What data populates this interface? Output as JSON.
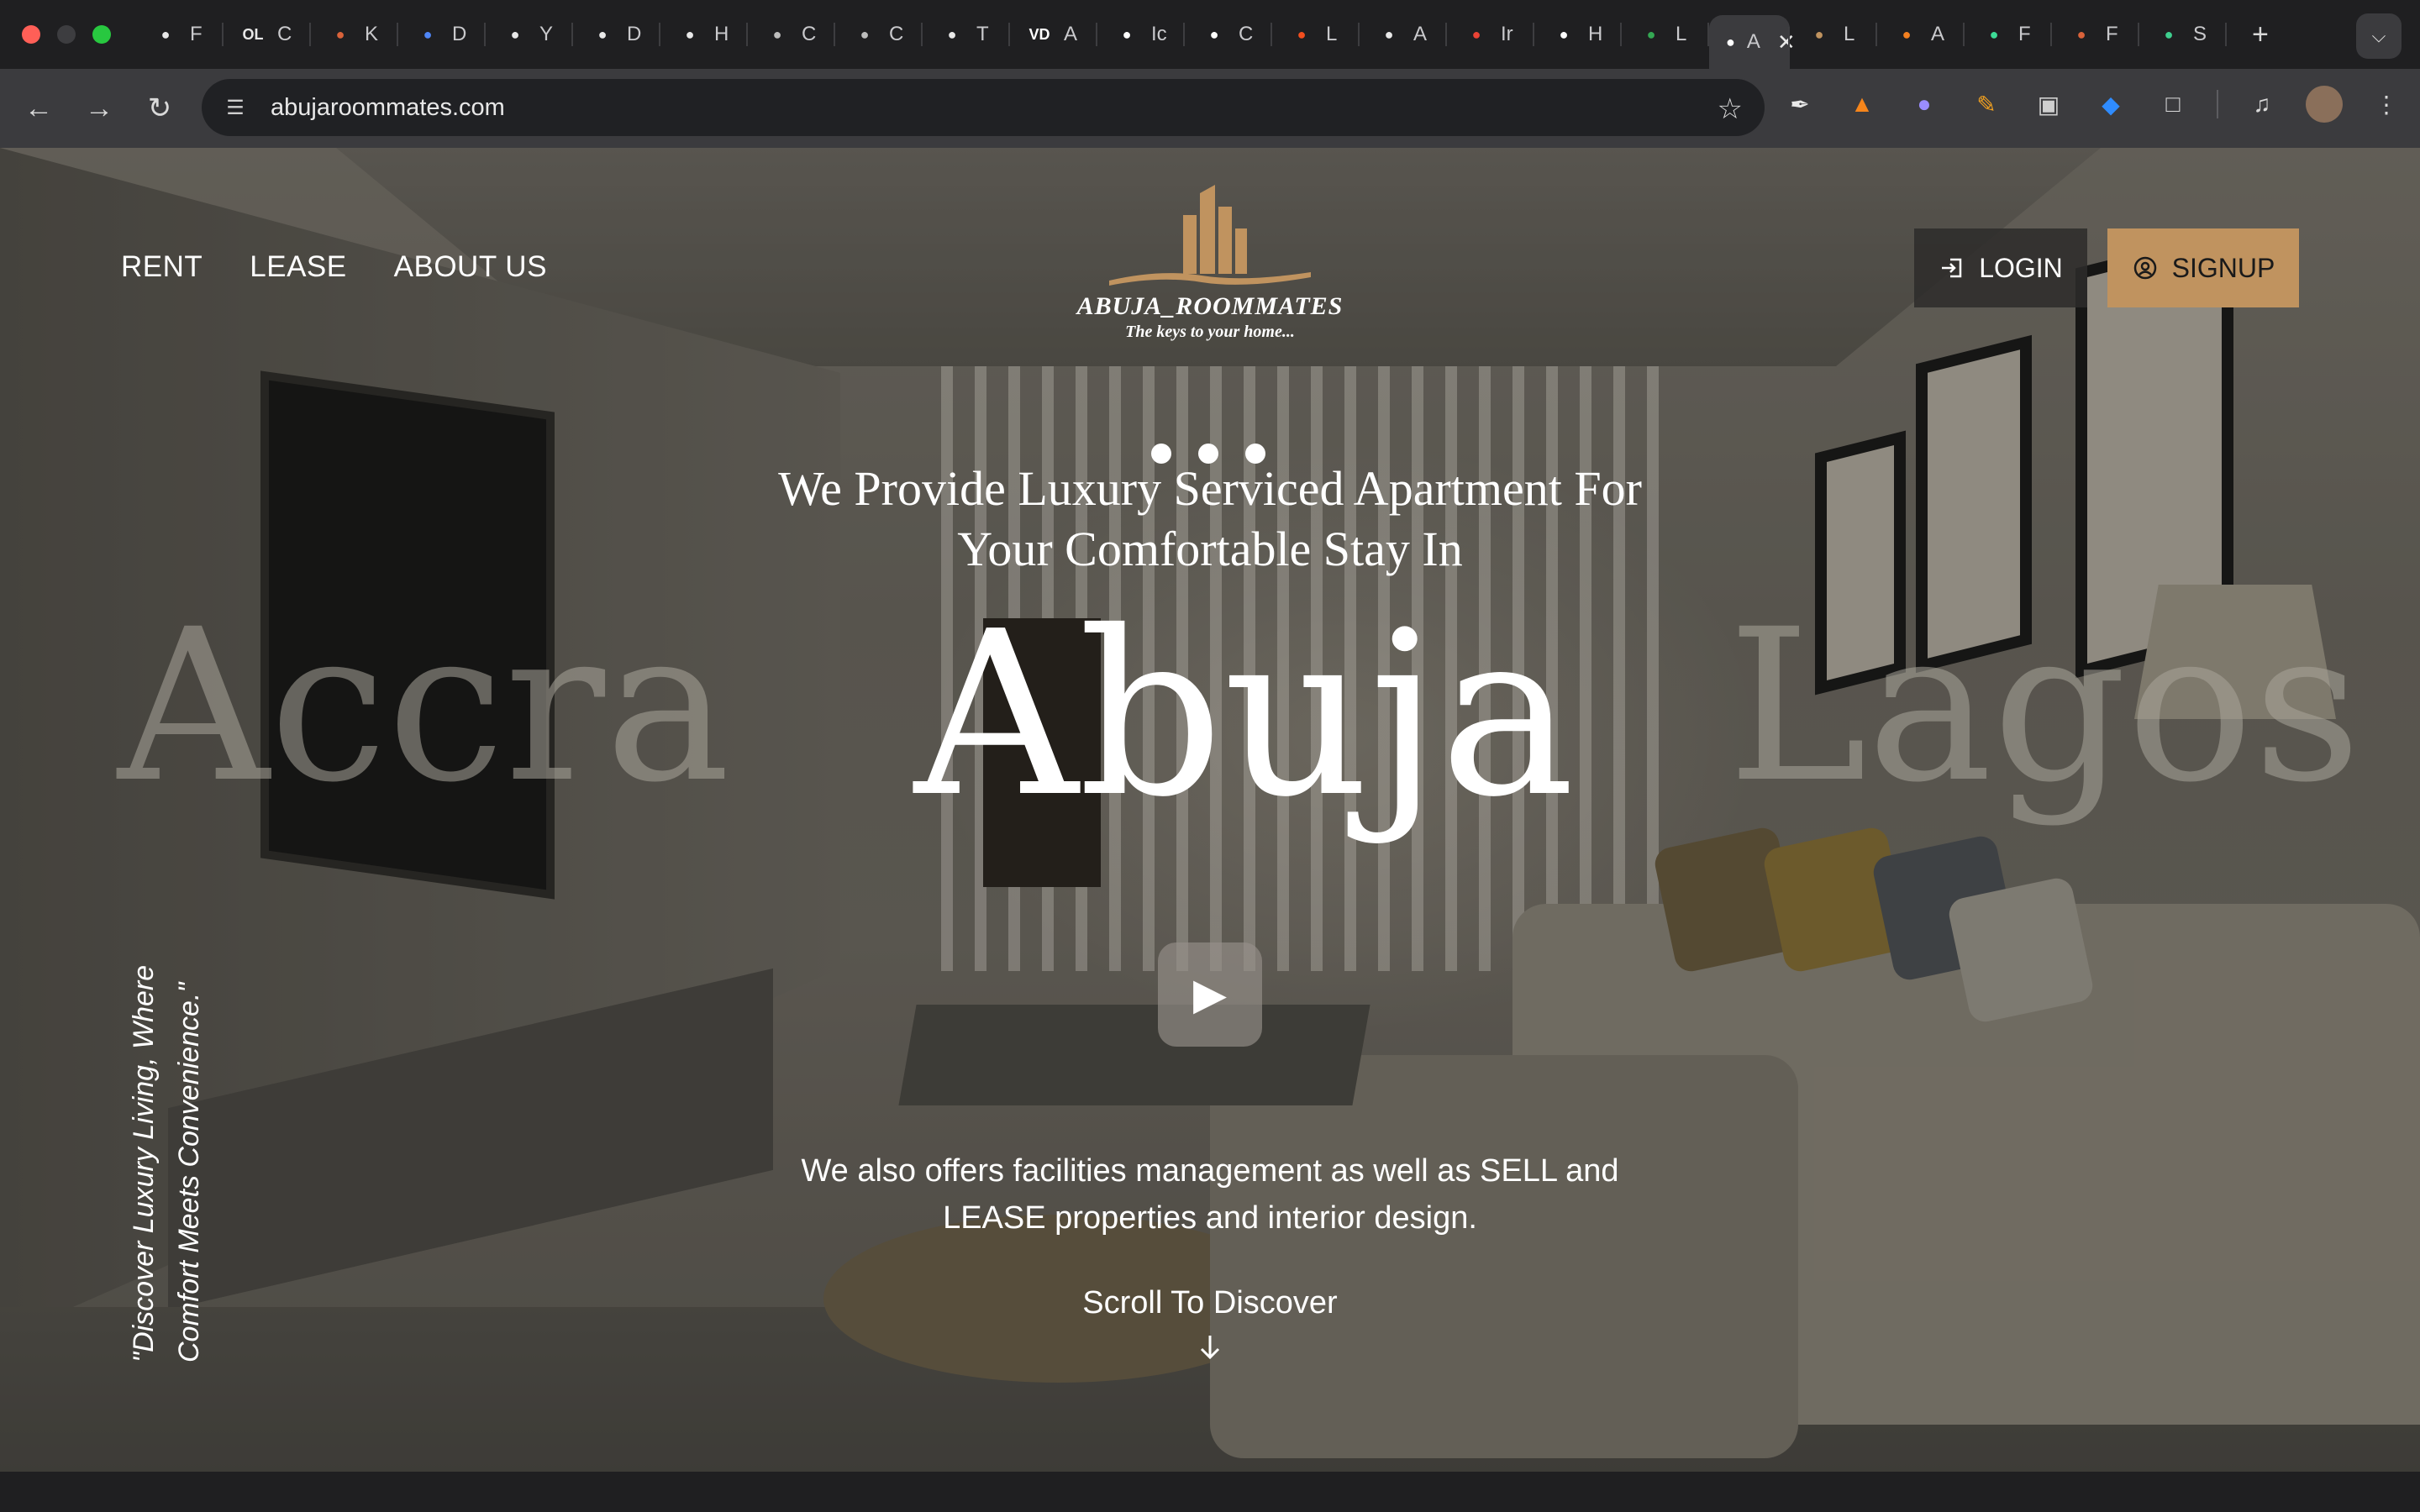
{
  "browser": {
    "tabs": [
      {
        "icon": "openai-icon",
        "title": "F",
        "color": "#e8e8e8"
      },
      {
        "icon": "openlibrary-icon",
        "title": "C",
        "favicon_text": "OL",
        "color": "#e8e8e8"
      },
      {
        "icon": "app-icon",
        "title": "K",
        "color": "#d9623a"
      },
      {
        "icon": "docs-icon",
        "title": "D",
        "color": "#4f86f7"
      },
      {
        "icon": "github-icon",
        "title": "Y",
        "color": "#e8e8e8"
      },
      {
        "icon": "github-icon",
        "title": "D",
        "color": "#e8e8e8"
      },
      {
        "icon": "site-icon",
        "title": "H",
        "color": "#e8e8e8"
      },
      {
        "icon": "globe-icon",
        "title": "C",
        "color": "#bdbdbd"
      },
      {
        "icon": "globe-icon",
        "title": "C",
        "color": "#bdbdbd"
      },
      {
        "icon": "book-icon",
        "title": "T",
        "color": "#e8e8e8"
      },
      {
        "icon": "app-icon",
        "title": "A",
        "favicon_text": "VD",
        "color": "#ffffff"
      },
      {
        "icon": "notion-icon",
        "title": "Ic",
        "color": "#ffffff"
      },
      {
        "icon": "site-icon",
        "title": "C",
        "color": "#ffffff"
      },
      {
        "icon": "figma-icon",
        "title": "L",
        "color": "#f24e1e"
      },
      {
        "icon": "speaker-icon",
        "title": "A",
        "color": "#e8e8e8"
      },
      {
        "icon": "gmail-icon",
        "title": "Ir",
        "color": "#ea4335"
      },
      {
        "icon": "x-icon",
        "title": "H",
        "color": "#ffffff"
      },
      {
        "icon": "play-icon",
        "title": "L",
        "color": "#34a853"
      },
      {
        "icon": "site-icon",
        "title": "A",
        "active": true,
        "color": "#ffffff"
      },
      {
        "icon": "site-icon",
        "title": "L",
        "color": "#c0935f"
      },
      {
        "icon": "cloud-icon",
        "title": "A",
        "color": "#f38020"
      },
      {
        "icon": "site-icon",
        "title": "F",
        "color": "#3ddc97"
      },
      {
        "icon": "site-icon",
        "title": "F",
        "color": "#d9623a"
      },
      {
        "icon": "bolt-icon",
        "title": "S",
        "color": "#3ecf8e"
      }
    ],
    "url": "abujaroommates.com"
  },
  "site": {
    "nav": {
      "rent": "RENT",
      "lease": "LEASE",
      "about": "ABOUT US"
    },
    "logo": {
      "name": "ABUJA_ROOMMATES",
      "tagline": "The keys to your home..."
    },
    "auth": {
      "login": "LOGIN",
      "signup": "SIGNUP"
    },
    "hero": {
      "headline_line1": "We Provide Luxury Serviced Apartment For",
      "headline_line2": "Your Comfortable Stay In",
      "city_prev": "Accra",
      "city_current": "Abuja",
      "city_next": "Lagos",
      "subtext_line1": "We also offers facilities management as well as SELL and",
      "subtext_line2": "LEASE properties and interior design.",
      "scroll_label": "Scroll To Discover",
      "quote_line1": "\"Discover Luxury Living, Where",
      "quote_line2": "Comfort Meets Convenience.\""
    },
    "colors": {
      "accent": "#c0935f",
      "overlay": "#1e1c18"
    }
  }
}
